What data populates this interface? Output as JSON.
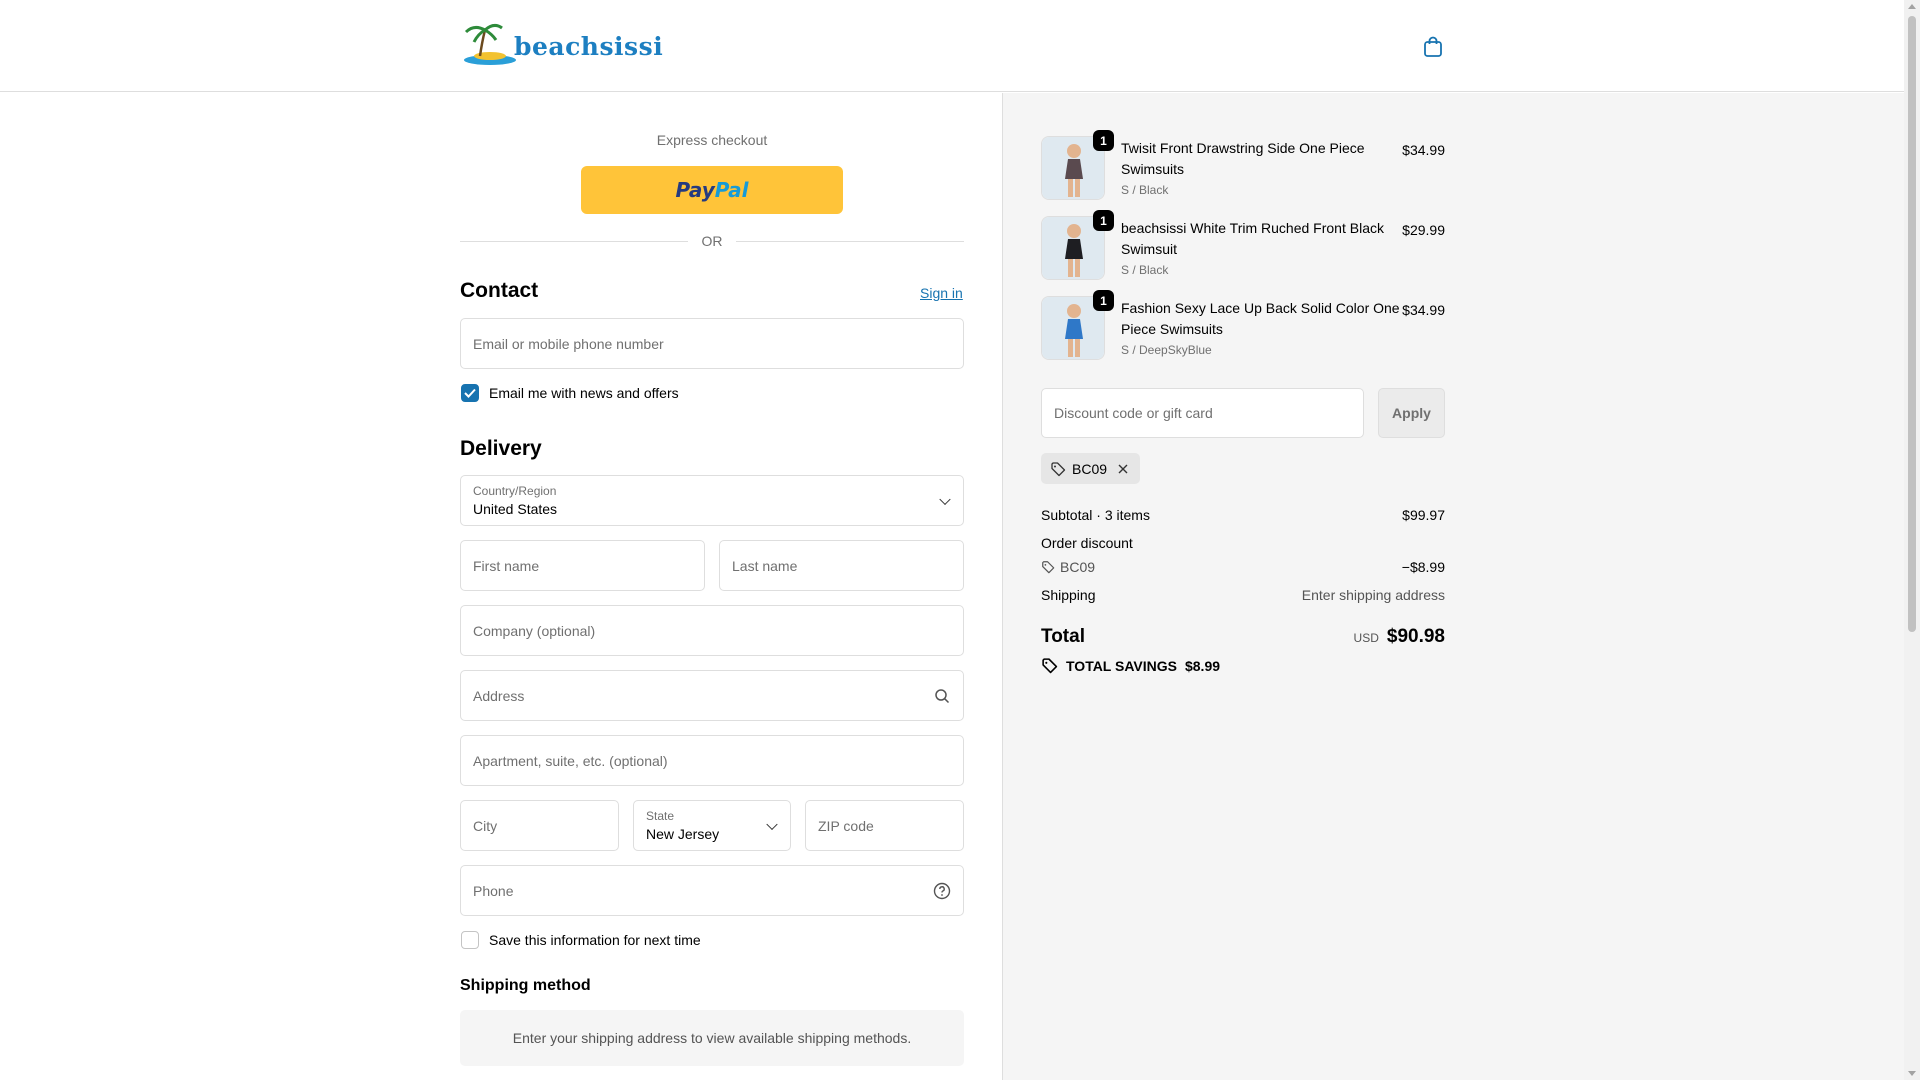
{
  "brand": {
    "name": "beachsissi"
  },
  "express": {
    "label": "Express checkout",
    "paypal_a": "Pay",
    "paypal_b": "Pal",
    "or": "OR"
  },
  "contact": {
    "heading": "Contact",
    "signin": "Sign in",
    "email_placeholder": "Email or mobile phone number",
    "news_label": "Email me with news and offers",
    "news_checked": true
  },
  "delivery": {
    "heading": "Delivery",
    "country_label": "Country/Region",
    "country_value": "United States",
    "first_name": "First name",
    "last_name": "Last name",
    "company": "Company (optional)",
    "address": "Address",
    "apartment": "Apartment, suite, etc. (optional)",
    "city": "City",
    "state_label": "State",
    "state_value": "New Jersey",
    "zip": "ZIP code",
    "phone": "Phone",
    "save_label": "Save this information for next time",
    "save_checked": false
  },
  "shipping_method": {
    "heading": "Shipping method",
    "info": "Enter your shipping address to view available shipping methods."
  },
  "cart": {
    "items": [
      {
        "title": "Twisit Front Drawstring Side One Piece Swimsuits",
        "variant": "S / Black",
        "price": "$34.99",
        "qty": "1",
        "swatch": "#5a4a4f"
      },
      {
        "title": "beachsissi White Trim Ruched Front Black Swimsuit",
        "variant": "S / Black",
        "price": "$29.99",
        "qty": "1",
        "swatch": "#1e1e22"
      },
      {
        "title": "Fashion Sexy Lace Up Back Solid Color One Piece Swimsuits",
        "variant": "S / DeepSkyBlue",
        "price": "$34.99",
        "qty": "1",
        "swatch": "#2f78c8"
      }
    ]
  },
  "discount": {
    "placeholder": "Discount code or gift card",
    "apply": "Apply",
    "code": "BC09"
  },
  "summary": {
    "subtotal_label": "Subtotal · 3 items",
    "subtotal_value": "$99.97",
    "order_discount_label": "Order discount",
    "discount_code": "BC09",
    "discount_value": "−$8.99",
    "shipping_label": "Shipping",
    "shipping_value": "Enter shipping address",
    "total_label": "Total",
    "currency": "USD",
    "total_value": "$90.98",
    "savings_label": "TOTAL SAVINGS",
    "savings_value": "$8.99"
  },
  "colors": {
    "accent": "#1773b0",
    "paypal": "#ffc439",
    "right_bg": "#f5f5f5"
  }
}
